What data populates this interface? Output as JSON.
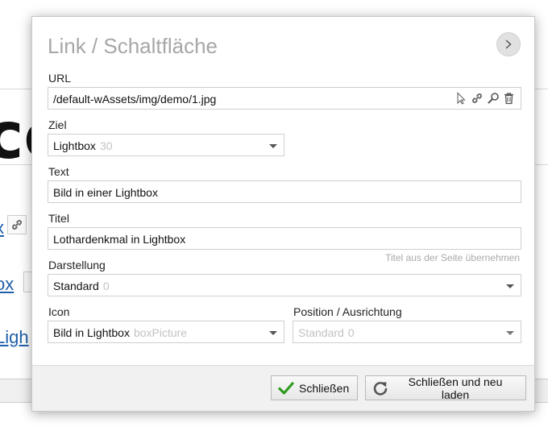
{
  "background": {
    "heading_fragment": "ce",
    "link_fragments": [
      "x",
      "ox",
      "Ligh"
    ]
  },
  "dialog": {
    "title": "Link / Schaltfläche",
    "url": {
      "label": "URL",
      "value": "/default-wAssets/img/demo/1.jpg",
      "icons": [
        "select-cursor-icon",
        "link-icon",
        "search-icon",
        "trash-icon"
      ]
    },
    "ziel": {
      "label": "Ziel",
      "value": "Lightbox",
      "code": "30"
    },
    "text": {
      "label": "Text",
      "value": "Bild in einer Lightbox"
    },
    "titel": {
      "label": "Titel",
      "value": "Lothardenkmal in Lightbox",
      "hint": "Titel aus der Seite übernehmen"
    },
    "darstellung": {
      "label": "Darstellung",
      "value": "Standard",
      "code": "0"
    },
    "icon": {
      "label": "Icon",
      "value": "Bild in Lightbox",
      "code": "boxPicture"
    },
    "position": {
      "label": "Position / Ausrichtung",
      "value": "Standard",
      "code": "0"
    },
    "buttons": {
      "close": "Schließen",
      "close_reload": "Schließen und neu laden"
    },
    "colors": {
      "check_green": "#2e9b1f",
      "reload_gray": "#555555",
      "title_gray": "#a7a7a7"
    }
  }
}
